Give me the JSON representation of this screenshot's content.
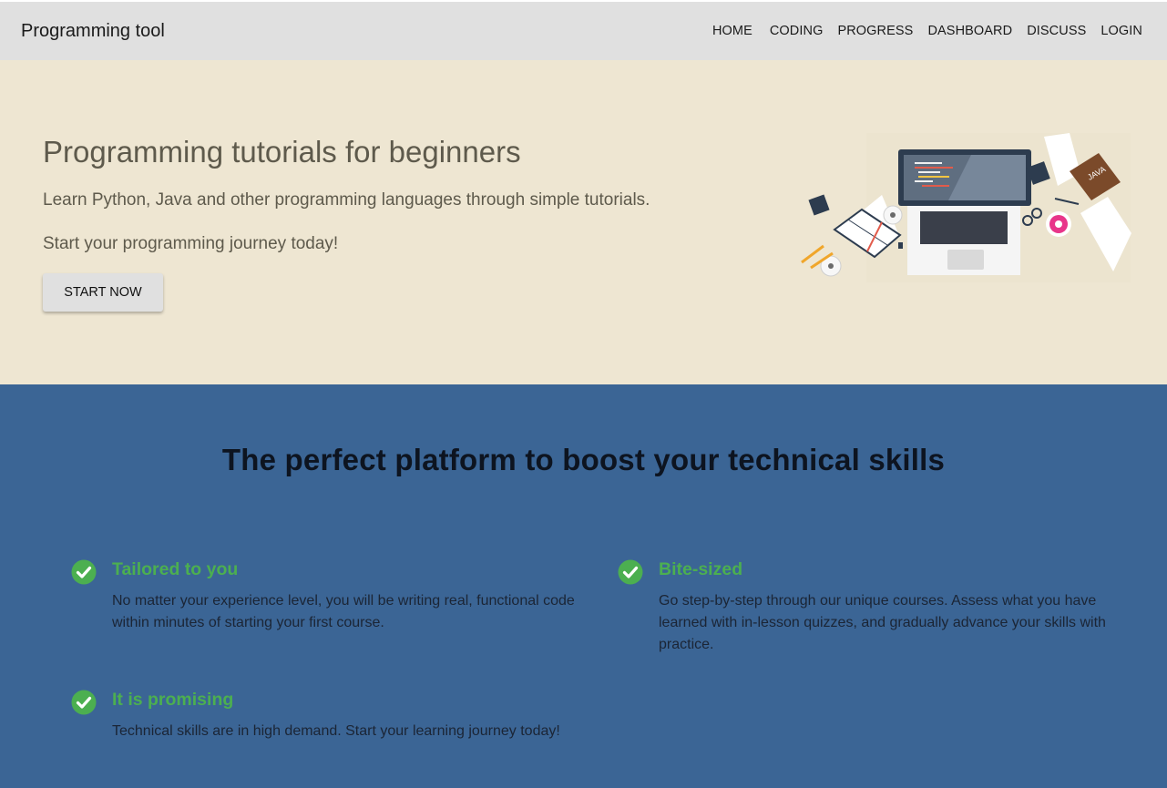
{
  "brand": "Programming tool",
  "nav": [
    "HOME",
    "CODING",
    "PROGRESS",
    "DASHBOARD",
    "DISCUSS",
    "LOGIN"
  ],
  "hero": {
    "title": "Programming tutorials for beginners",
    "subtitle": "Learn Python, Java and other programming languages through simple tutorials.",
    "subtitle2": "Start your programming journey today!",
    "button": "START NOW",
    "illustration_book_label": "JAVA"
  },
  "features": {
    "title": "The perfect platform to boost your technical skills",
    "items": [
      {
        "title": "Tailored to you",
        "text": "No matter your experience level, you will be writing real, functional code within minutes of starting your first course."
      },
      {
        "title": "Bite-sized",
        "text": "Go step-by-step through our unique courses. Assess what you have learned with in-lesson quizzes, and gradually advance your skills with practice."
      },
      {
        "title": "It is promising",
        "text": "Technical skills are in high demand. Start your learning journey today!"
      }
    ]
  },
  "colors": {
    "navbar": "#e0e0e0",
    "hero_bg": "#eee6d2",
    "features_bg": "#3b6595",
    "accent_green": "#4caf50"
  },
  "icons": [
    "check-circle-icon"
  ]
}
